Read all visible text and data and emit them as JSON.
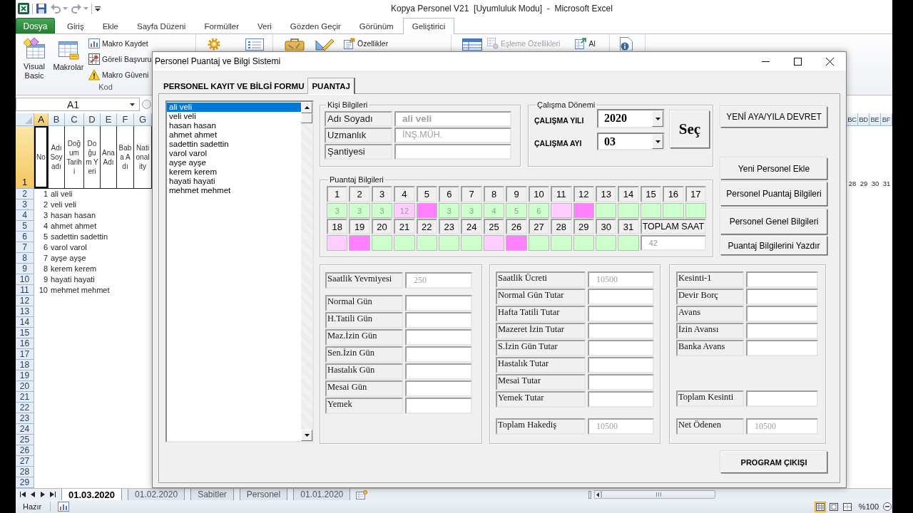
{
  "excel": {
    "title": "Kopya Personel V21  [Uyumluluk Modu]  -  Microsoft Excel",
    "ribbon_tabs": [
      {
        "label": "Dosya",
        "kind": "file",
        "selected": false
      },
      {
        "label": "Giriş",
        "kind": "tab",
        "selected": false
      },
      {
        "label": "Ekle",
        "kind": "tab",
        "selected": false
      },
      {
        "label": "Sayfa Düzeni",
        "kind": "tab",
        "selected": false
      },
      {
        "label": "Formüller",
        "kind": "tab",
        "selected": false
      },
      {
        "label": "Veri",
        "kind": "tab",
        "selected": false
      },
      {
        "label": "Gözden Geçir",
        "kind": "tab",
        "selected": false
      },
      {
        "label": "Görünüm",
        "kind": "tab",
        "selected": false
      },
      {
        "label": "Geliştirici",
        "kind": "tab",
        "selected": true
      }
    ],
    "code_group": {
      "label": "Kod",
      "large_buttons": [
        {
          "label": "Visual Basic",
          "kind": "editor"
        },
        {
          "label": "Makrolar",
          "kind": "macros"
        }
      ],
      "small_buttons": [
        {
          "label": "Makro Kaydet",
          "kind": "record"
        },
        {
          "label": "Göreli Başvuru",
          "kind": "relative"
        },
        {
          "label": "Makro Güveni",
          "kind": "security"
        }
      ]
    },
    "controls_buttons": [
      {
        "label": "Özellikler",
        "kind": "properties",
        "disabled": false
      }
    ],
    "xml_buttons": [
      {
        "label": "Eşleme Özellikleri",
        "kind": "map",
        "disabled": true
      },
      {
        "label": "Al",
        "kind": "import",
        "disabled": false
      }
    ],
    "name_box": "A1",
    "columns": [
      {
        "label": "A",
        "selected": true
      },
      {
        "label": "B",
        "selected": false
      },
      {
        "label": "C",
        "selected": false
      },
      {
        "label": "D",
        "selected": false
      },
      {
        "label": "E",
        "selected": false
      },
      {
        "label": "F",
        "selected": false
      },
      {
        "label": "G",
        "selected": false
      }
    ],
    "right_columns": [
      "BC",
      "BD",
      "BE",
      "BF"
    ],
    "header_row": {
      "number": "1",
      "selected": true,
      "cells": [
        "No",
        "Adı Soyadı",
        "Doğum Tarihi",
        "Doğum Yeri",
        "Ana Adı",
        "Baba Adı",
        "Nationality"
      ],
      "right_cells": [
        "28",
        "29",
        "30",
        "31"
      ]
    },
    "rows": [
      {
        "number": "2",
        "no": "1",
        "name": "ali veli"
      },
      {
        "number": "3",
        "no": "2",
        "name": "veli veli"
      },
      {
        "number": "4",
        "no": "3",
        "name": "hasan hasan"
      },
      {
        "number": "5",
        "no": "4",
        "name": "ahmet ahmet"
      },
      {
        "number": "6",
        "no": "5",
        "name": "sadettin sadettin"
      },
      {
        "number": "7",
        "no": "6",
        "name": "varol varol"
      },
      {
        "number": "8",
        "no": "7",
        "name": "ayşe ayşe"
      },
      {
        "number": "9",
        "no": "8",
        "name": "kerem kerem"
      },
      {
        "number": "10",
        "no": "9",
        "name": "hayati hayati"
      },
      {
        "number": "11",
        "no": "10",
        "name": "mehmet mehmet"
      },
      {
        "number": "12"
      },
      {
        "number": "13"
      },
      {
        "number": "14"
      },
      {
        "number": "15"
      },
      {
        "number": "16"
      },
      {
        "number": "17"
      },
      {
        "number": "18"
      },
      {
        "number": "19"
      },
      {
        "number": "20"
      },
      {
        "number": "21"
      },
      {
        "number": "22"
      },
      {
        "number": "23"
      },
      {
        "number": "24"
      },
      {
        "number": "25"
      },
      {
        "number": "26"
      },
      {
        "number": "27"
      },
      {
        "number": "28"
      },
      {
        "number": "29"
      }
    ],
    "sheet_tabs": [
      {
        "label": "01.03.2020",
        "selected": true
      },
      {
        "label": "01.02.2020",
        "selected": false
      },
      {
        "label": "Sabitler",
        "selected": false
      },
      {
        "label": "Personel",
        "selected": false
      },
      {
        "label": "01.01.2020",
        "selected": false
      }
    ],
    "status": "Hazır",
    "view_buttons": [
      {
        "kind": "normal",
        "selected": true
      },
      {
        "kind": "page_layout",
        "selected": false
      },
      {
        "kind": "page_break",
        "selected": false
      }
    ],
    "zoom": "%100"
  },
  "dialog": {
    "title": "Personel Puantaj ve Bilgi Sistemi",
    "tabs": [
      {
        "label": "PERSONEL KAYIT VE BİLGİ FORMU",
        "selected": false
      },
      {
        "label": "PUANTAJ",
        "selected": true
      }
    ],
    "personnel_list": [
      {
        "label": "ali veli",
        "selected": true
      },
      {
        "label": "veli veli",
        "selected": false
      },
      {
        "label": "hasan hasan",
        "selected": false
      },
      {
        "label": "ahmet ahmet",
        "selected": false
      },
      {
        "label": "sadettin sadettin",
        "selected": false
      },
      {
        "label": "varol varol",
        "selected": false
      },
      {
        "label": "ayşe ayşe",
        "selected": false
      },
      {
        "label": "kerem kerem",
        "selected": false
      },
      {
        "label": "hayati hayati",
        "selected": false
      },
      {
        "label": "mehmet mehmet",
        "selected": false
      }
    ],
    "person_info": {
      "title": "Kişi Bilgileri",
      "fields": [
        {
          "label": "Adı Soyadı",
          "value": "ali veli"
        },
        {
          "label": "Uzmanlık",
          "value": "İNŞ.MÜH."
        },
        {
          "label": "Şantiyesi"
        }
      ]
    },
    "work_period": {
      "title": "Çalışma Dönemi",
      "fields": [
        {
          "label": "ÇALIŞMA YILI",
          "value": "2020"
        },
        {
          "label": "ÇALIŞMA AYI",
          "value": "03"
        }
      ],
      "button": "Seç"
    },
    "side_buttons": [
      "YENİ AYA/YILA DEVRET",
      "Yeni Personel Ekle",
      "Personel Puantaj Bilgileri",
      "Personel Genel Bilgileri",
      "Puantaj Bilgilerini Yazdır"
    ],
    "puantaj": {
      "title": "Puantaj Bilgileri",
      "days": [
        {
          "day": "1",
          "value": "3",
          "color": "#ccffcc"
        },
        {
          "day": "2",
          "value": "3",
          "color": "#ccffcc"
        },
        {
          "day": "3",
          "value": "3",
          "color": "#ccffcc"
        },
        {
          "day": "4",
          "value": "12",
          "color": "#ffccff"
        },
        {
          "day": "5",
          "color": "#ff80ff"
        },
        {
          "day": "6",
          "value": "3",
          "color": "#ccffcc"
        },
        {
          "day": "7",
          "value": "3",
          "color": "#ccffcc"
        },
        {
          "day": "8",
          "value": "4",
          "color": "#ccffcc"
        },
        {
          "day": "9",
          "value": "5",
          "color": "#ccffcc"
        },
        {
          "day": "10",
          "value": "6",
          "color": "#ccffcc"
        },
        {
          "day": "11",
          "color": "#ffccff"
        },
        {
          "day": "12",
          "color": "#ff80ff"
        },
        {
          "day": "13",
          "color": "#ccffcc"
        },
        {
          "day": "14",
          "color": "#ccffcc"
        },
        {
          "day": "15",
          "color": "#ccffcc"
        },
        {
          "day": "16",
          "color": "#ccffcc"
        },
        {
          "day": "17",
          "color": "#ccffcc"
        },
        {
          "day": "18",
          "color": "#ffccff"
        },
        {
          "day": "19",
          "color": "#ff80ff"
        },
        {
          "day": "20",
          "color": "#ccffcc"
        },
        {
          "day": "21",
          "color": "#ccffcc"
        },
        {
          "day": "22",
          "color": "#ccffcc"
        },
        {
          "day": "23",
          "color": "#ccffcc"
        },
        {
          "day": "24",
          "color": "#ccffcc"
        },
        {
          "day": "25",
          "color": "#ffccff"
        },
        {
          "day": "26",
          "color": "#ff80ff"
        },
        {
          "day": "27",
          "color": "#ccffcc"
        },
        {
          "day": "28",
          "color": "#ccffcc"
        },
        {
          "day": "29",
          "color": "#ccffcc"
        },
        {
          "day": "30",
          "color": "#ccffcc"
        },
        {
          "day": "31",
          "color": "#ccffcc"
        }
      ],
      "total_label": "TOPLAM SAAT",
      "total_value": "42"
    },
    "daily_panel": {
      "rate": {
        "label": "Saatlik Yevmiyesi",
        "value": "250"
      },
      "fields": [
        {
          "label": "Normal Gün"
        },
        {
          "label": "H.Tatili Gün"
        },
        {
          "label": "Maz.İzin Gün"
        },
        {
          "label": "Sen.İzin Gün"
        },
        {
          "label": "Hastalık Gün"
        },
        {
          "label": "Mesai Gün"
        },
        {
          "label": "Yemek"
        }
      ]
    },
    "amount_panel": {
      "rate": {
        "label": "Saatlik Ücreti",
        "value": "10500"
      },
      "fields": [
        {
          "label": "Normal Gün Tutar"
        },
        {
          "label": "Hafta Tatili Tutar"
        },
        {
          "label": "Mazeret İzin Tutar"
        },
        {
          "label": "S.İzin Gün Tutar"
        },
        {
          "label": "Hastalık Tutar"
        },
        {
          "label": "Mesai Tutar"
        },
        {
          "label": "Yemek Tutar"
        }
      ],
      "total": {
        "label": "Toplam Hakediş",
        "value": "10500"
      }
    },
    "deduction_panel": {
      "fields": [
        {
          "label": "Kesinti-1"
        },
        {
          "label": "Devir Borç"
        },
        {
          "label": "Avans"
        },
        {
          "label": "İzin Avansı"
        },
        {
          "label": "Banka Avans"
        }
      ],
      "total": {
        "label": "Toplam Kesinti"
      },
      "net": {
        "label": "Net Ödenen",
        "value": "10500"
      }
    },
    "exit_button": "PROGRAM ÇIKIŞI"
  }
}
